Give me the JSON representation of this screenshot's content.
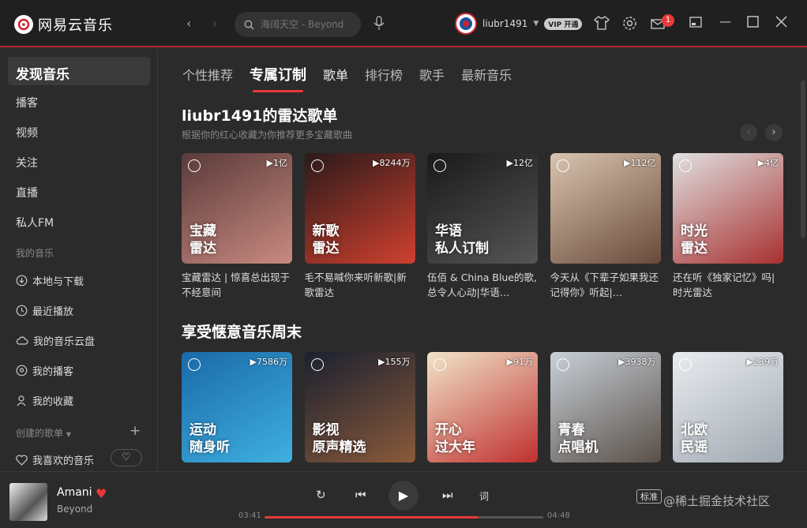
{
  "app": {
    "title": "网易云音乐"
  },
  "search": {
    "placeholder": "海阔天空 - Beyond"
  },
  "user": {
    "name": "liubr1491",
    "vip": "VIP 开通"
  },
  "header": {
    "mail_count": "1"
  },
  "sidebar": {
    "main": "发现音乐",
    "items": [
      "播客",
      "视频",
      "关注",
      "直播",
      "私人FM"
    ],
    "section_my": "我的音乐",
    "my_items": [
      "本地与下载",
      "最近播放",
      "我的音乐云盘",
      "我的播客",
      "我的收藏"
    ],
    "section_created": "创建的歌单",
    "liked": "我喜欢的音乐"
  },
  "tabs": [
    "个性推荐",
    "专属订制",
    "歌单",
    "排行榜",
    "歌手",
    "最新音乐"
  ],
  "radar": {
    "title": "liubr1491的雷达歌单",
    "subtitle": "根据你的红心收藏为你推荐更多宝藏歌曲",
    "cards": [
      {
        "plays": "▶1亿",
        "title": "宝藏\n雷达",
        "desc": "宝藏雷达 | 惊喜总出现于不经意间",
        "color1": "#5a3a3a",
        "color2": "#c98a80"
      },
      {
        "plays": "▶8244万",
        "title": "新歌\n雷达",
        "desc": "毛不易喊你来听新歌|新歌雷达",
        "color1": "#2a1a1a",
        "color2": "#d0402f"
      },
      {
        "plays": "▶12亿",
        "title": "华语\n私人订制",
        "desc": "伍佰 & China Blue的歌,总令人心动|华语…",
        "color1": "#1a1a1a",
        "color2": "#555555"
      },
      {
        "plays": "▶112亿",
        "title": "",
        "desc": "今天从《下辈子如果我还记得你》听起|…",
        "color1": "#d8c4b0",
        "color2": "#6a4a3a"
      },
      {
        "plays": "▶4亿",
        "title": "时光\n雷达",
        "desc": "还在听《独家记忆》吗|时光雷达",
        "color1": "#e0e0e0",
        "color2": "#a83030"
      }
    ]
  },
  "weekend": {
    "title": "享受惬意音乐周末",
    "cards": [
      {
        "plays": "▶7586万",
        "title": "运动\n随身听",
        "color1": "#1a6aa8",
        "color2": "#3fb0e0"
      },
      {
        "plays": "▶155万",
        "title": "影视\n原声精选",
        "color1": "#1a2030",
        "color2": "#8a5a3a"
      },
      {
        "plays": "▶91万",
        "title": "开心\n过大年",
        "color1": "#f0e4c8",
        "color2": "#c03030"
      },
      {
        "plays": "▶3938万",
        "title": "青春\n点唱机",
        "color1": "#c8d0d8",
        "color2": "#5a5048"
      },
      {
        "plays": "▶239万",
        "title": "北欧\n民谣",
        "color1": "#e8ecf0",
        "color2": "#a0a8b0"
      }
    ]
  },
  "player": {
    "song": "Amani",
    "artist": "Beyond",
    "elapsed": "03:41",
    "total": "04:48",
    "progress": 0.768,
    "lyrics_btn": "词",
    "quality": "标准",
    "watermark": "@稀土掘金技术社区"
  }
}
